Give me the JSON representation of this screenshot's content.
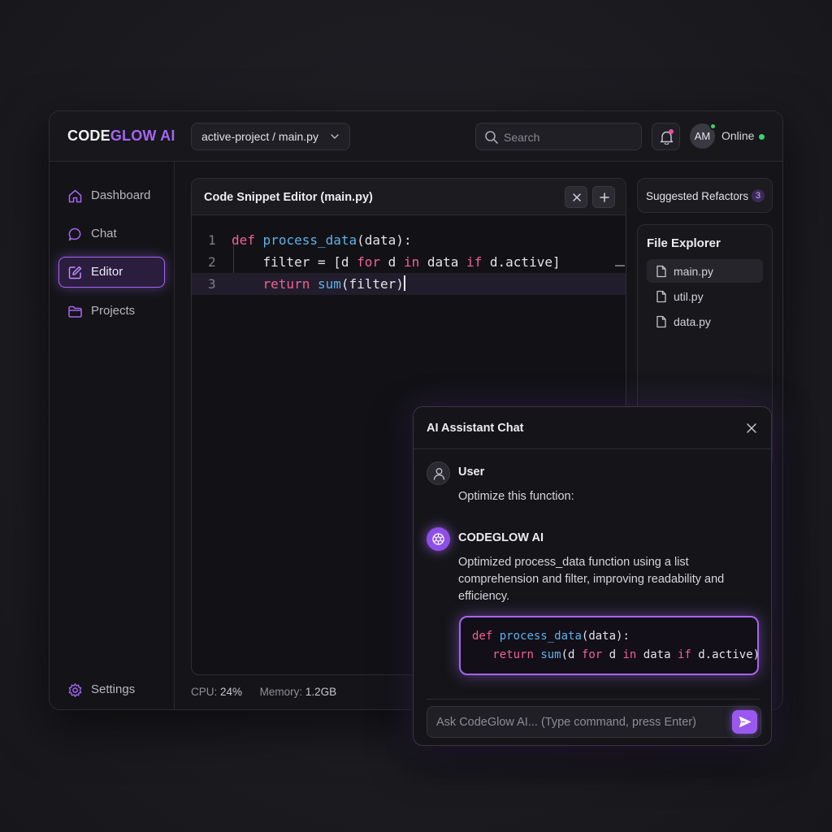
{
  "header": {
    "brand_part1": "CODE",
    "brand_part2": "GLOW AI",
    "project_path": "active-project / main.py",
    "search_placeholder": "Search",
    "avatar_initials": "AM",
    "status": "Online"
  },
  "sidebar": {
    "items": [
      {
        "label": "Dashboard",
        "icon": "home-icon",
        "active": false
      },
      {
        "label": "Chat",
        "icon": "chat-bubble-icon",
        "active": false
      },
      {
        "label": "Editor",
        "icon": "edit-icon",
        "active": true
      },
      {
        "label": "Projects",
        "icon": "folder-icon",
        "active": false
      }
    ],
    "settings_label": "Settings"
  },
  "editor": {
    "title": "Code Snippet Editor (main.py)",
    "line_numbers": [
      "1",
      "2",
      "3"
    ],
    "lines": [
      "def process_data(data):",
      "    filter = [d for d in data if d.active]",
      "    return sum(filter)"
    ]
  },
  "footer": {
    "cpu_label": "CPU:",
    "cpu_value": "24%",
    "memory_label": "Memory:",
    "memory_value": "1.2GB"
  },
  "refactors": {
    "label": "Suggested Refactors",
    "count": "3"
  },
  "explorer": {
    "title": "File Explorer",
    "files": [
      "main.py",
      "util.py",
      "data.py"
    ],
    "selected": "main.py"
  },
  "chat": {
    "title": "AI Assistant Chat",
    "messages": [
      {
        "sender": "User",
        "text": "Optimize this function:"
      },
      {
        "sender": "CODEGLOW AI",
        "text": "Optimized process_data function using a list comprehension and filter, improving readability and efficiency."
      }
    ],
    "code_lines": [
      "def process_data(data):",
      "   return sum(d for d in data if d.active)"
    ],
    "input_placeholder": "Ask CodeGlow AI... (Type command, press Enter)"
  },
  "colors": {
    "accent": "#a565f4",
    "keyword": "#f06292",
    "function": "#5fb1ec",
    "online": "#37d36a",
    "notification": "#ee4aa8"
  }
}
